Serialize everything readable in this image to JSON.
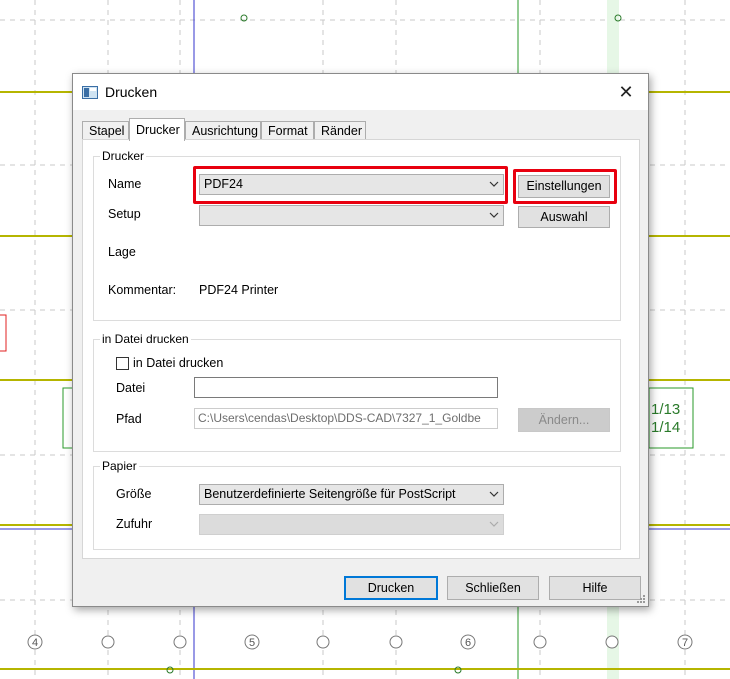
{
  "dialog": {
    "title": "Drucken",
    "close_glyph": "✕"
  },
  "tabs": [
    {
      "label": "Stapel"
    },
    {
      "label": "Drucker",
      "active": true
    },
    {
      "label": "Ausrichtung"
    },
    {
      "label": "Format"
    },
    {
      "label": "Ränder"
    }
  ],
  "printer_group": {
    "title": "Drucker",
    "name_label": "Name",
    "name_value": "PDF24",
    "setup_label": "Setup",
    "setup_value": "",
    "location_label": "Lage",
    "comment_label": "Kommentar:",
    "comment_value": "PDF24 Printer",
    "settings_button": "Einstellungen",
    "select_button": "Auswahl"
  },
  "file_group": {
    "title": "in Datei drucken",
    "checkbox_label": "in Datei drucken",
    "checked": false,
    "file_label": "Datei",
    "file_value": "",
    "path_label": "Pfad",
    "path_value": "C:\\Users\\cendas\\Desktop\\DDS-CAD\\7327_1_Goldbe",
    "change_button": "Ändern..."
  },
  "paper_group": {
    "title": "Papier",
    "size_label": "Größe",
    "size_value": "Benutzerdefinierte Seitengröße für PostScript",
    "feed_label": "Zufuhr",
    "feed_value": ""
  },
  "footer": {
    "print_button": "Drucken",
    "close_button": "Schließen",
    "help_button": "Hilfe"
  },
  "cad": {
    "axis_labels": [
      "4",
      "5",
      "6",
      "7"
    ],
    "right_text_1": "1/13",
    "right_text_2": "1/14",
    "line_color": "#c8c800",
    "text_color": "#2a7a2a"
  },
  "colors": {
    "highlight": "#e8000f",
    "default_button_border": "#0078d7"
  }
}
